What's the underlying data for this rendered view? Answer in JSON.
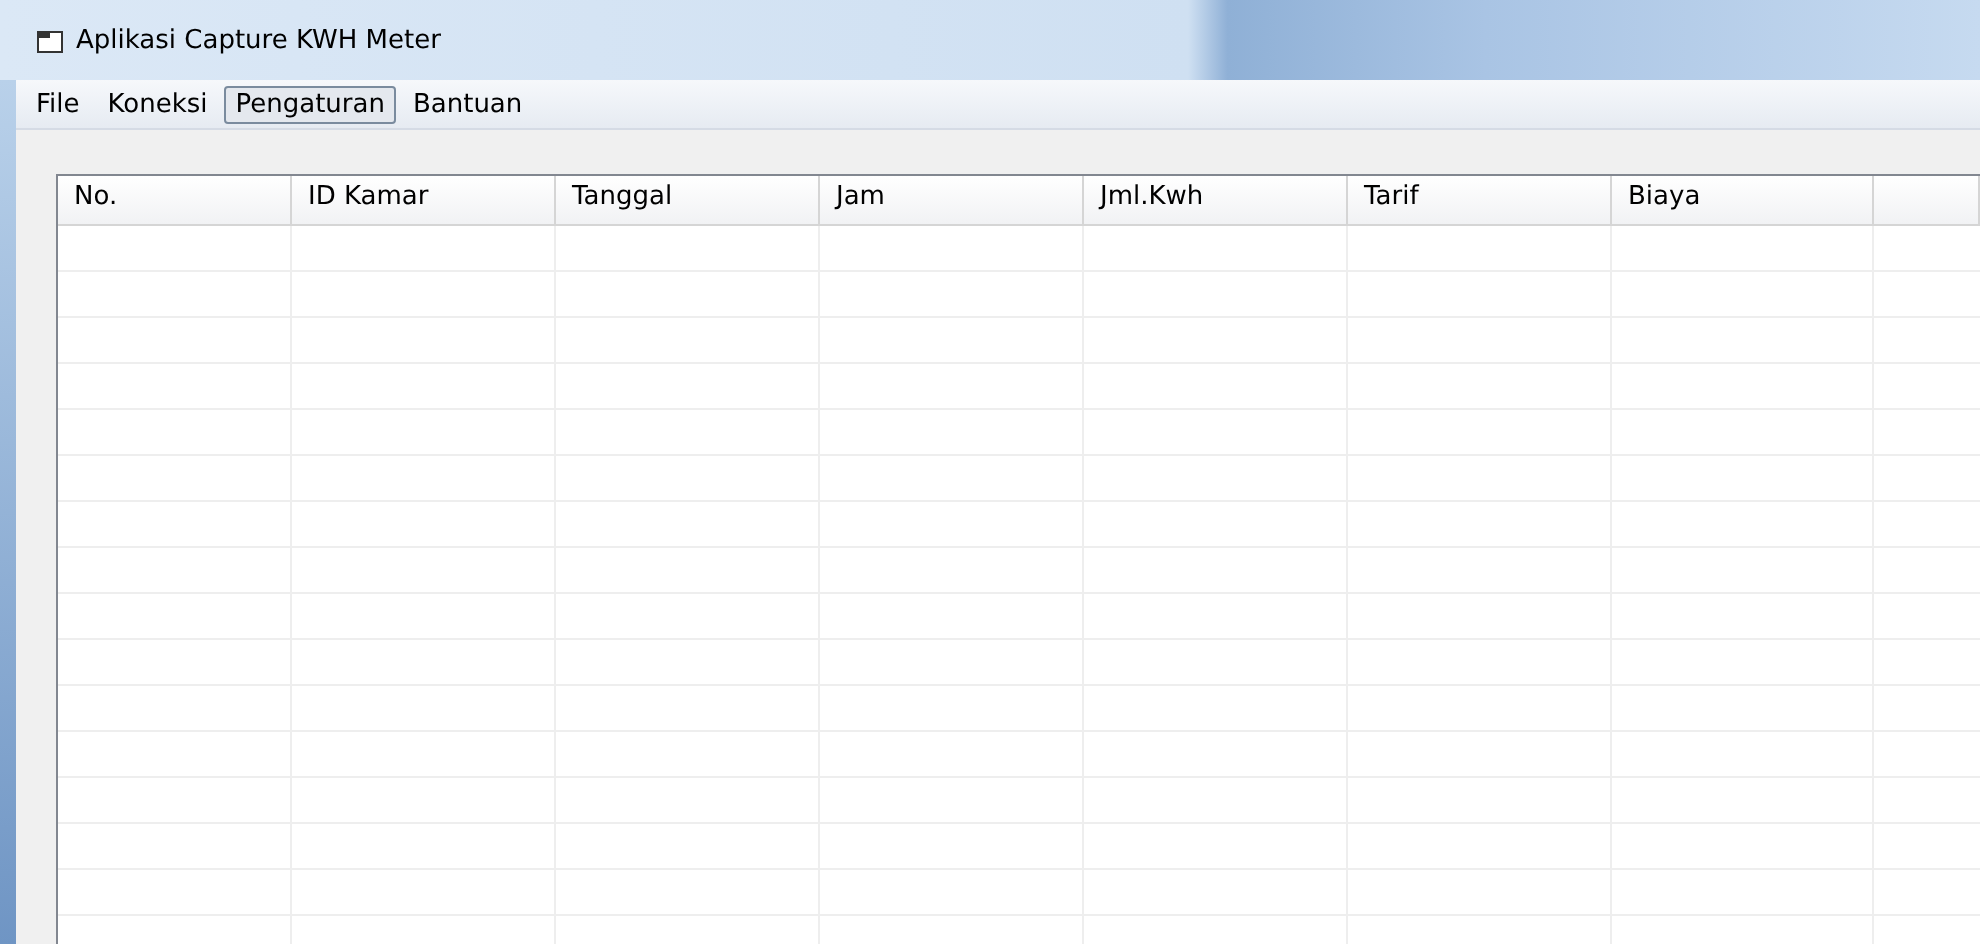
{
  "window": {
    "title": "Aplikasi Capture KWH Meter"
  },
  "menu": [
    {
      "label": "File",
      "selected": false
    },
    {
      "label": "Koneksi",
      "selected": false
    },
    {
      "label": "Pengaturan",
      "selected": true
    },
    {
      "label": "Bantuan",
      "selected": false
    }
  ],
  "table": {
    "columns": [
      "No.",
      "ID Kamar",
      "Tanggal",
      "Jam",
      "Jml.Kwh",
      "Tarif",
      "Biaya"
    ]
  }
}
